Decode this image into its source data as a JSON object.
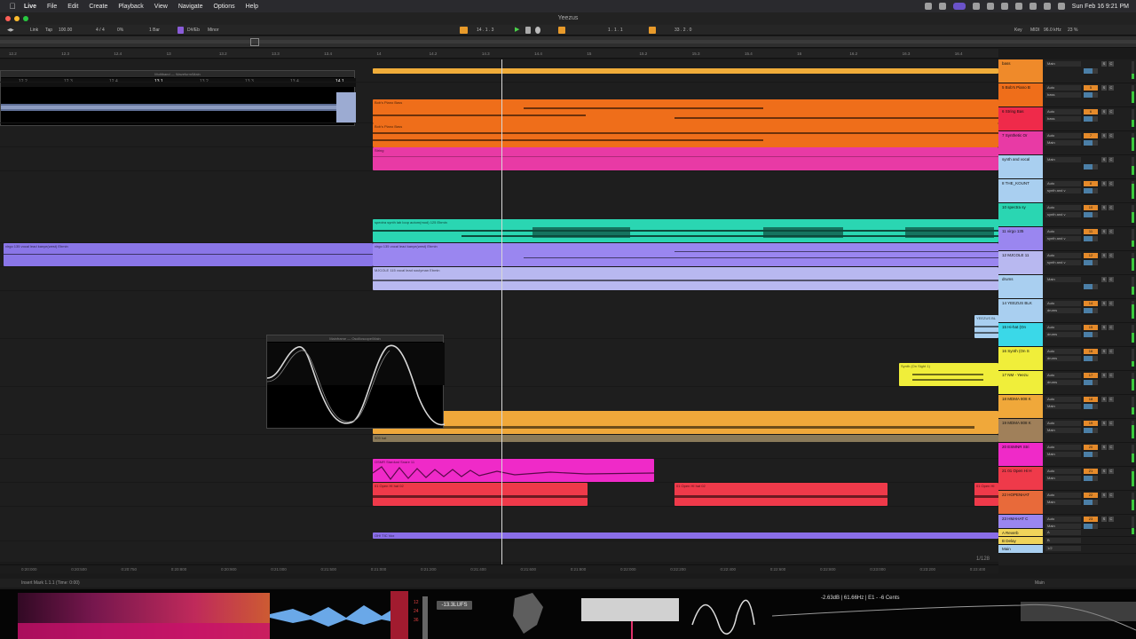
{
  "menubar": {
    "app": "Live",
    "items": [
      "File",
      "Edit",
      "Create",
      "Playback",
      "View",
      "Navigate",
      "Options",
      "Help"
    ],
    "clock": "Sun Feb 16  9:21 PM"
  },
  "window": {
    "title": "Yeezus"
  },
  "control": {
    "link": "Link",
    "tap": "Tap",
    "tempo": "100.00",
    "signature": "4 / 4",
    "cpu": "0%",
    "quantize": "1 Bar",
    "scale_root": "D#/Eb",
    "scale_name": "Minor",
    "position": "14 .  1 .  3",
    "loop_start": "1 .  1 .  1",
    "loop_length": "33 .  2 .  0",
    "key": "Key",
    "midi": "MIDI",
    "sample_rate": "96.0 kHz",
    "cpu_load": "23 %"
  },
  "ruler": [
    "12.2",
    "12.3",
    "12.4",
    "13",
    "13.2",
    "13.3",
    "13.4",
    "14",
    "14.2",
    "14.3",
    "14.4",
    "15",
    "15.2",
    "15.3",
    "15.4",
    "16",
    "16.2",
    "16.3",
    "16.4"
  ],
  "clip_detail": [
    "12.2",
    "12.3",
    "12.4",
    "13.1",
    "13.2",
    "13.3",
    "13.4",
    "14.1"
  ],
  "clips": {
    "bass_piano_1": "Bob's Piano Bass",
    "bass_piano_2": "Bob's Piano Bass",
    "string": "String",
    "spectra": "spectra  synth  lab  loop  autom(mod)  125  Ebmin",
    "virgo_left": "virgo  135  vocal  lead  kanye(west)  Ebmin",
    "virgo_right": "virgo  135  vocal  lead  kanye(west)  Ebmin",
    "mjcole": "MJCOLE  115  vocal  lead  soulyman  Ebmin",
    "yeezus_small": "YEEZUS BL",
    "synth_on_sight": "Synth (On Sight 1)",
    "kick_909": "909 kick",
    "hihat_909": "909 hat",
    "osmr_snare": "OSMR Stardust Snare 11",
    "open_hh_1": "01 Open HI hat 02",
    "open_hh_2": "01 Open HI hat 02",
    "open_hh_3": "01 Open HI",
    "vox_fx": "OH!  TIC  Vox"
  },
  "float_windows": {
    "top": "Multiband — Waveform/Main",
    "mid": "Mainframe — Oscilloscope/Main"
  },
  "tracks": [
    {
      "name": "bass",
      "io": "Main",
      "io2": "",
      "num": "",
      "color": "#ef8a2a"
    },
    {
      "name": "5 Bob's Piano B",
      "io": "Auto",
      "io2": "bass",
      "num": "5",
      "color": "#ef6e1a"
    },
    {
      "name": "6 String Bas",
      "io": "Auto",
      "io2": "bass",
      "num": "6",
      "color": "#ef2a4a"
    },
    {
      "name": "7 Synthetic Or",
      "io": "Auto",
      "io2": "Main",
      "num": "7",
      "color": "#e83aa5"
    },
    {
      "name": "synth and vocal",
      "io": "Main",
      "io2": "",
      "num": "",
      "color": "#a9cff0"
    },
    {
      "name": "8 THE_KOUNT",
      "io": "Auto",
      "io2": "synth and v",
      "num": "8",
      "color": "#a9cff0"
    },
    {
      "name": "10 spectra  sy",
      "io": "Auto",
      "io2": "synth and v",
      "num": "10",
      "color": "#2ad6b2"
    },
    {
      "name": "11 virgo  135",
      "io": "Auto",
      "io2": "synth and v",
      "num": "11",
      "color": "#9a86f0"
    },
    {
      "name": "12 MJCOLE  11",
      "io": "Auto",
      "io2": "synth and v",
      "num": "12",
      "color": "#b8b8f0"
    },
    {
      "name": "drums",
      "io": "Main",
      "io2": "",
      "num": "",
      "color": "#a9cff0"
    },
    {
      "name": "14 YEEZUS BLK",
      "io": "Auto",
      "io2": "drums",
      "num": "14",
      "color": "#a9cff0"
    },
    {
      "name": "15 Hi-hat (On",
      "io": "Auto",
      "io2": "drums",
      "num": "15",
      "color": "#3ad8e8"
    },
    {
      "name": "16 Synth (On S",
      "io": "Auto",
      "io2": "drums",
      "num": "16",
      "color": "#f0ee3a"
    },
    {
      "name": "17 NM - Yeezu",
      "io": "Auto",
      "io2": "drums",
      "num": "17",
      "color": "#f0ee3a"
    },
    {
      "name": "18 MDMA 808 K",
      "io": "Auto",
      "io2": "Main",
      "num": "18",
      "color": "#f0a83a"
    },
    {
      "name": "19 MDMA 808 K",
      "io": "Auto",
      "io2": "Main",
      "num": "19",
      "color": "#a0805a"
    },
    {
      "name": "20 ESMNR Stri",
      "io": "Auto",
      "io2": "Main",
      "num": "20",
      "color": "#ef2ac8"
    },
    {
      "name": "21 01 Open Hi H",
      "io": "Auto",
      "io2": "Main",
      "num": "21",
      "color": "#ef3a4a"
    },
    {
      "name": "22 HOPENHAT",
      "io": "Auto",
      "io2": "Main",
      "num": "22",
      "color": "#e86a3a"
    },
    {
      "name": "23 HMAHAT  C",
      "io": "Auto",
      "io2": "Main",
      "num": "23",
      "color": "#9a86f0"
    },
    {
      "name": "A Reverb",
      "io": "",
      "io2": "",
      "num": "A",
      "color": "#f0d45a"
    },
    {
      "name": "B Delay",
      "io": "",
      "io2": "",
      "num": "B",
      "color": "#f0d45a"
    },
    {
      "name": "Main",
      "io": "1/2",
      "io2": "",
      "num": "",
      "color": "#a9cff0"
    }
  ],
  "time_ruler": [
    "0:20:000",
    "0:20:500",
    "0:20:750",
    "0:20:800",
    "0:20:900",
    "0:21:000",
    "0:21:500",
    "0:21:000",
    "0:21:200",
    "0:21:400",
    "0:21:600",
    "0:21:800",
    "0:22:000",
    "0:22:200",
    "0:22:400",
    "0:22:600",
    "0:22:800",
    "0:23:000",
    "0:23:200",
    "0:23:400"
  ],
  "zoom": "1/128",
  "status": {
    "left": "Insert Mark 1.1.1 (Time: 0:00)",
    "right": "Main"
  },
  "analyzer": {
    "lufs": "-13.3LUFS",
    "meter_ticks": [
      "12",
      "24",
      "36"
    ],
    "readout": "-2.63dB  |  61.66Hz  |  E1  -  -6 Cents"
  }
}
